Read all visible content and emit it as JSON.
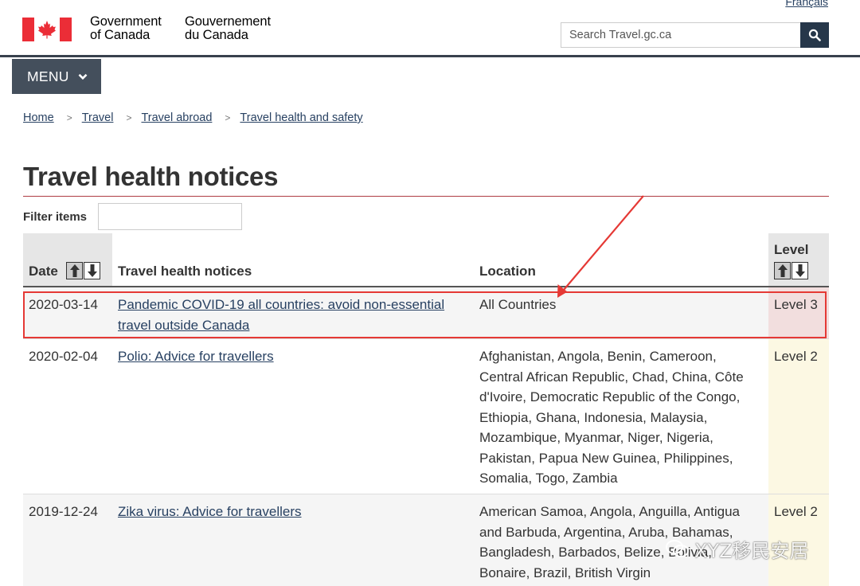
{
  "lang_toggle": "Français",
  "header": {
    "gov_en_line1": "Government",
    "gov_en_line2": "of Canada",
    "gov_fr_line1": "Gouvernement",
    "gov_fr_line2": "du Canada",
    "search_placeholder": "Search Travel.gc.ca",
    "search_icon": "search-icon"
  },
  "menu": {
    "label": "MENU",
    "icon": "chevron-down-icon"
  },
  "breadcrumb": [
    "Home",
    "Travel",
    "Travel abroad",
    "Travel health and safety"
  ],
  "page": {
    "title": "Travel health notices",
    "filter_label": "Filter items"
  },
  "table": {
    "headers": {
      "date": "Date",
      "notice": "Travel health notices",
      "location": "Location",
      "level": "Level"
    },
    "rows": [
      {
        "date": "2020-03-14",
        "notice": "Pandemic COVID-19 all countries: avoid non-essential travel outside Canada",
        "location": "All Countries",
        "level": "Level 3"
      },
      {
        "date": "2020-02-04",
        "notice": "Polio: Advice for travellers",
        "location": "Afghanistan, Angola, Benin, Cameroon, Central African Republic, Chad, China, Côte d'Ivoire, Democratic Republic of the Congo, Ethiopia, Ghana, Indonesia, Malaysia, Mozambique, Myanmar, Niger, Nigeria, Pakistan, Papua New Guinea, Philippines, Somalia, Togo, Zambia",
        "level": "Level 2"
      },
      {
        "date": "2019-12-24",
        "notice": "Zika virus: Advice for travellers",
        "location": "American Samoa, Angola, Anguilla, Antigua and Barbuda, Argentina, Aruba, Bahamas, Bangladesh, Barbados, Belize, Bolivia, Bonaire, Brazil, British Virgin",
        "level": "Level 2"
      }
    ]
  },
  "colors": {
    "header_rule": "#38414d",
    "menu_bg": "#444f5c",
    "link": "#284162",
    "title_rule": "#af3c43",
    "level3_bg": "#f2dede",
    "level2_bg": "#fcf8e3",
    "annotation_red": "#e53935",
    "flag_red": "#eb2d37"
  },
  "watermark": "XYZ移民安居"
}
